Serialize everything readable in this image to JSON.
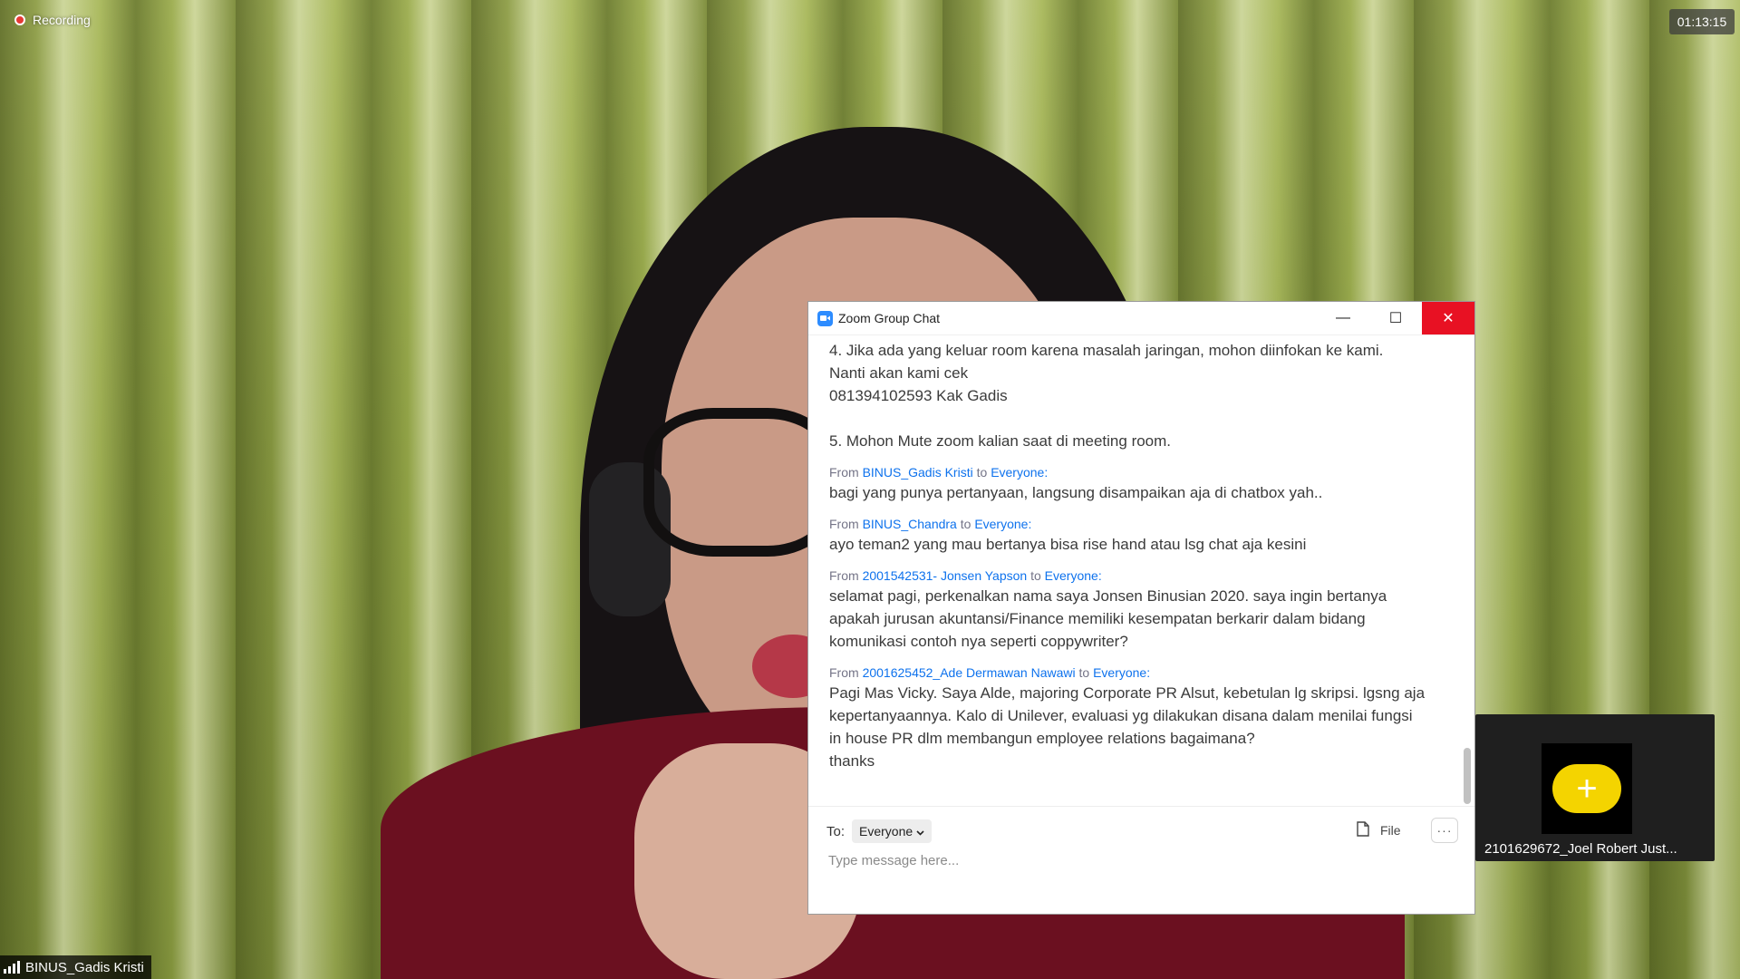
{
  "recording": {
    "label": "Recording"
  },
  "timer": {
    "value": "01:13:15"
  },
  "speaker": {
    "name": "BINUS_Gadis Kristi"
  },
  "thumbnail": {
    "name": "2101629672_Joel Robert Just..."
  },
  "chat": {
    "title": "Zoom Group Chat",
    "window_buttons": {
      "minimize": "—",
      "maximize": "☐",
      "close": "✕"
    },
    "first_text": "4. Jika ada yang keluar room karena masalah jaringan, mohon diinfokan ke kami.\nNanti akan kami cek\n081394102593 Kak Gadis\n\n5. Mohon Mute zoom kalian saat di meeting room.",
    "messages": [
      {
        "from_label": "From",
        "sender": "BINUS_Gadis Kristi",
        "to_label": "to",
        "recipient": "Everyone:",
        "text": "bagi yang punya pertanyaan, langsung disampaikan aja di chatbox yah.."
      },
      {
        "from_label": "From",
        "sender": "BINUS_Chandra",
        "to_label": "to",
        "recipient": "Everyone:",
        "text": "ayo teman2 yang mau bertanya bisa rise hand atau lsg chat aja kesini"
      },
      {
        "from_label": "From",
        "sender": "2001542531- Jonsen Yapson",
        "to_label": "to",
        "recipient": "Everyone:",
        "text": "selamat pagi, perkenalkan nama saya Jonsen Binusian 2020. saya ingin bertanya apakah jurusan akuntansi/Finance memiliki kesempatan berkarir dalam bidang komunikasi contoh nya seperti coppywriter?"
      },
      {
        "from_label": "From",
        "sender": "2001625452_Ade Dermawan Nawawi",
        "to_label": "to",
        "recipient": "Everyone:",
        "text": "Pagi Mas Vicky. Saya Alde, majoring Corporate PR Alsut, kebetulan lg skripsi. lgsng aja kepertanyaannya. Kalo di Unilever, evaluasi yg dilakukan disana dalam menilai fungsi in house PR dlm membangun employee relations bagaimana?\nthanks"
      }
    ],
    "composer": {
      "to_label": "To:",
      "recipient": "Everyone",
      "file_label": "File",
      "more_label": "···",
      "placeholder": "Type message here..."
    }
  }
}
